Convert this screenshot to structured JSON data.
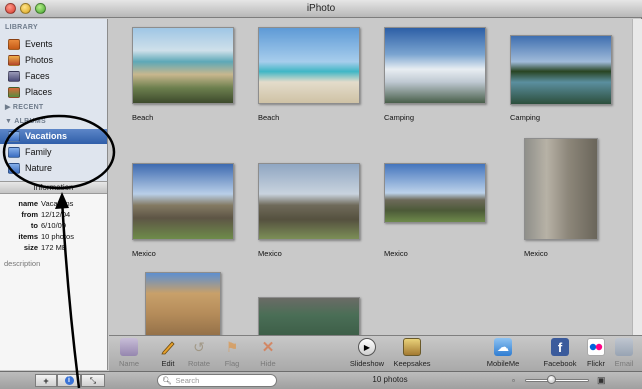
{
  "window": {
    "title": "iPhoto"
  },
  "sidebar": {
    "library_header": "LIBRARY",
    "library_items": [
      {
        "label": "Events",
        "icon": "events-icon"
      },
      {
        "label": "Photos",
        "icon": "photos-icon"
      },
      {
        "label": "Faces",
        "icon": "faces-icon"
      },
      {
        "label": "Places",
        "icon": "places-icon"
      }
    ],
    "recent_header": "▶ RECENT",
    "albums_header": "▼ ALBUMS",
    "albums": [
      {
        "label": "Vacations",
        "selected": true
      },
      {
        "label": "Family",
        "selected": false
      },
      {
        "label": "Nature",
        "selected": false
      }
    ]
  },
  "info": {
    "header": "Information",
    "rows": [
      {
        "key": "name",
        "value": "Vacations"
      },
      {
        "key": "from",
        "value": "12/12/04"
      },
      {
        "key": "to",
        "value": "6/10/09"
      },
      {
        "key": "items",
        "value": "10 photos"
      },
      {
        "key": "size",
        "value": "172 MB"
      }
    ],
    "description_placeholder": "description"
  },
  "photos": [
    {
      "caption": "Beach"
    },
    {
      "caption": "Beach"
    },
    {
      "caption": "Camping"
    },
    {
      "caption": "Camping"
    },
    {
      "caption": "Mexico"
    },
    {
      "caption": "Mexico"
    },
    {
      "caption": "Mexico"
    },
    {
      "caption": "Mexico"
    },
    {
      "caption": ""
    },
    {
      "caption": ""
    }
  ],
  "toolbar": {
    "name": "Name",
    "edit": "Edit",
    "rotate": "Rotate",
    "flag": "Flag",
    "hide": "Hide",
    "slideshow": "Slideshow",
    "keepsakes": "Keepsakes",
    "mobileme": "MobileMe",
    "facebook": "Facebook",
    "flickr": "Flickr",
    "email": "Email"
  },
  "statusbar": {
    "search_placeholder": "Search",
    "photo_count": "10 photos",
    "zoom_level": 0.4
  },
  "colors": {
    "selection": "#2f5ea9",
    "annotation": "#000000"
  }
}
